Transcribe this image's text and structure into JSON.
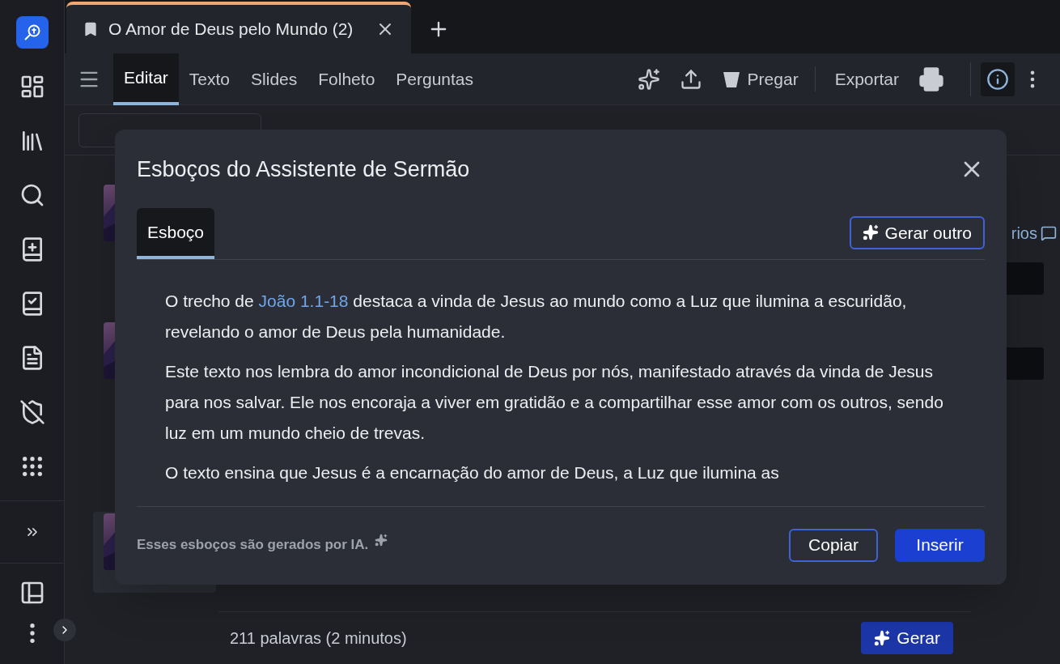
{
  "sidebar": {
    "items": [
      {
        "kind": "logo"
      },
      {
        "kind": "dashboard"
      },
      {
        "kind": "library"
      },
      {
        "kind": "search"
      },
      {
        "kind": "bible"
      },
      {
        "kind": "checklist"
      },
      {
        "kind": "document"
      },
      {
        "kind": "shield"
      },
      {
        "kind": "apps"
      }
    ],
    "bottom_items": [
      {
        "kind": "expand"
      },
      {
        "kind": "layout"
      },
      {
        "kind": "more"
      }
    ]
  },
  "document_tabs": [
    {
      "title": "O Amor de Deus pelo Mundo (2)",
      "selected": true
    }
  ],
  "view_tabs": [
    {
      "label": "Editar",
      "selected": true
    },
    {
      "label": "Texto",
      "selected": false
    },
    {
      "label": "Slides",
      "selected": false
    },
    {
      "label": "Folheto",
      "selected": false
    },
    {
      "label": "Perguntas",
      "selected": false
    }
  ],
  "actions": {
    "preach": "Pregar",
    "export": "Exportar"
  },
  "background": {
    "comments_link": "rios"
  },
  "footer": {
    "word_count": "211 palavras (2 minutos)",
    "generate_button": "Gerar"
  },
  "modal": {
    "title": "Esboços do Assistente de Sermão",
    "tabs": [
      {
        "label": "Esboço",
        "selected": true
      }
    ],
    "generate_other": "Gerar outro",
    "paragraphs": [
      {
        "parts": [
          {
            "kind": "text",
            "text": "O trecho de "
          },
          {
            "kind": "link",
            "text": "João 1.1-18"
          },
          {
            "kind": "text",
            "text": " destaca a vinda de Jesus ao mundo como a Luz que ilumina a escuridão, revelando o amor de Deus pela humanidade."
          }
        ]
      },
      {
        "parts": [
          {
            "kind": "text",
            "text": "Este texto nos lembra do amor incondicional de Deus por nós, manifestado através da vinda de Jesus para nos salvar. Ele nos encoraja a viver em gratidão e a compartilhar esse amor com os outros, sendo luz em um mundo cheio de trevas."
          }
        ]
      },
      {
        "parts": [
          {
            "kind": "text",
            "text": "O texto ensina que Jesus é a encarnação do amor de Deus, a Luz que ilumina as"
          }
        ]
      }
    ],
    "note": "Esses esboços são gerados por IA.",
    "buttons": {
      "copy": "Copiar",
      "insert": "Inserir"
    }
  }
}
